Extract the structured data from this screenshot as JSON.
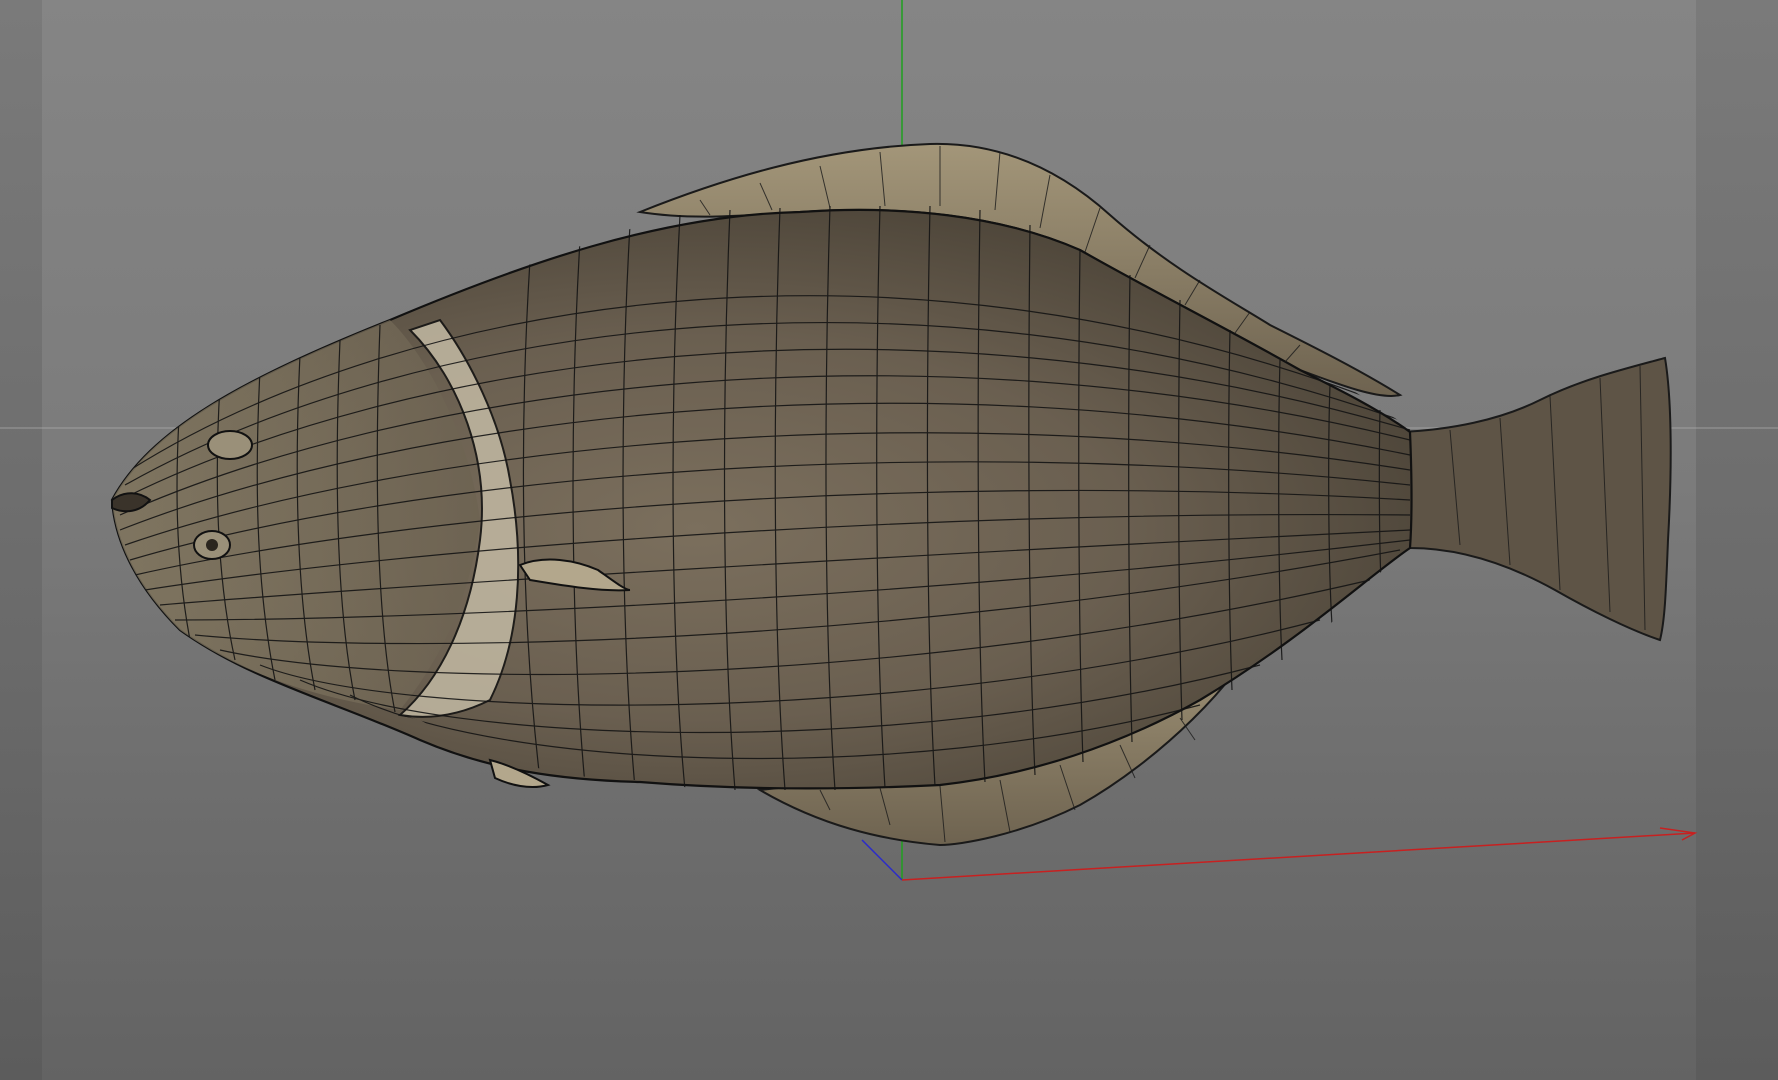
{
  "viewport": {
    "background_top": "#858585",
    "background_bottom": "#636363",
    "frame_color": "#5e5e5e"
  },
  "axes": {
    "x_color": "#c82020",
    "y_color": "#1fa01f",
    "z_color": "#2a2acc",
    "horizon_color": "#a8a8a8"
  },
  "model": {
    "subject": "halibut-3d-model",
    "display_mode": "textured-with-wireframe",
    "skin_color": "#6e6252",
    "wire_color": "#111111"
  }
}
